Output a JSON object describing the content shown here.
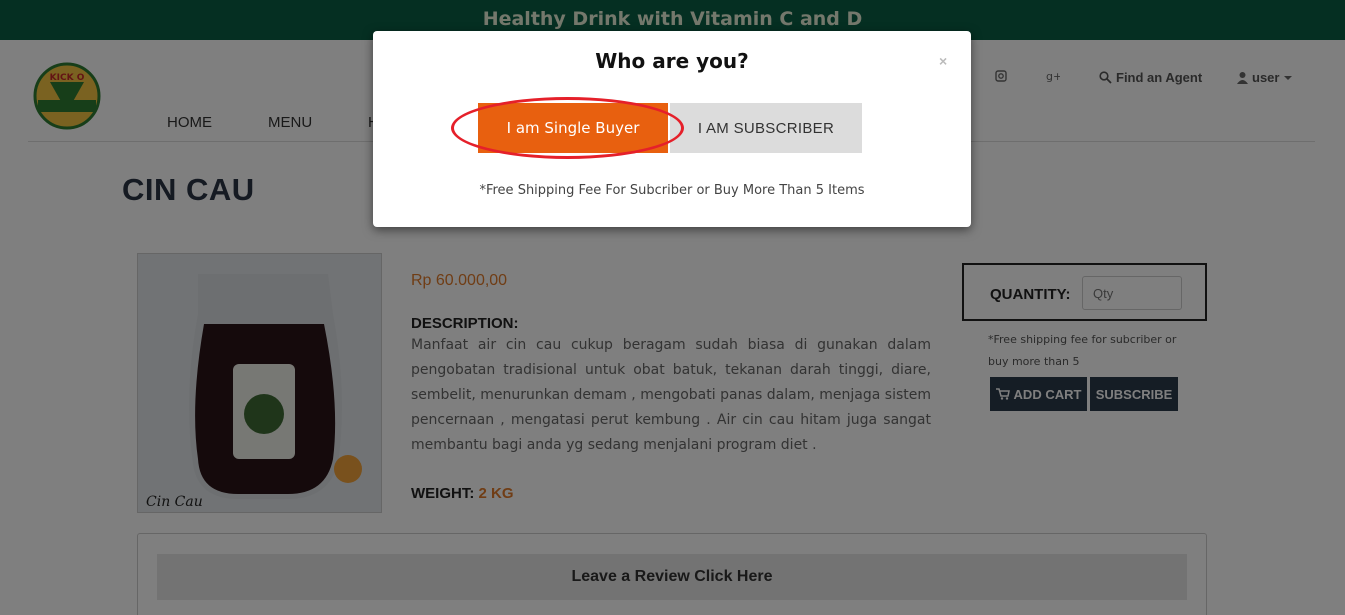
{
  "banner": {
    "text": "Healthy Drink with Vitamin C and D"
  },
  "logo": {
    "text": "KICK O"
  },
  "nav": {
    "home": "HOME",
    "menu": "MENU",
    "h": "H"
  },
  "header_right": {
    "instagram_icon": "instagram-icon",
    "googleplus_icon": "google-plus-icon",
    "find_agent": "Find an Agent",
    "user": "user"
  },
  "product": {
    "title": "CIN CAU",
    "image_caption": "Cin Cau",
    "price": "Rp 60.000,00",
    "description_label": "DESCRIPTION:",
    "description": "Manfaat air cin cau cukup beragam sudah biasa di gunakan dalam pengobatan tradisional untuk obat batuk, tekanan darah tinggi, diare, sembelit, menurunkan demam , mengobati panas dalam, menjaga sistem pencernaan , mengatasi perut kembung . Air cin cau hitam juga sangat membantu bagi anda yg sedang menjalani program diet .",
    "weight_label": "WEIGHT:",
    "weight_value": "2 KG"
  },
  "purchase": {
    "quantity_label": "QUANTITY:",
    "qty_placeholder": "Qty",
    "shipping_note": "*Free shipping fee for subcriber or buy more than 5",
    "add_cart": "ADD CART",
    "subscribe": "SUBSCRIBE"
  },
  "review": {
    "button": "Leave a Review Click Here"
  },
  "modal": {
    "title": "Who are you?",
    "close": "×",
    "single_buyer": "I am Single Buyer",
    "subscriber": "I AM SUBSCRIBER",
    "note": "*Free Shipping Fee For Subcriber or Buy More Than 5 Items"
  },
  "colors": {
    "banner": "#0b5f45",
    "accent_orange": "#e8600f",
    "price": "#e07a2a",
    "dark_button": "#2b3a4a",
    "highlight_circle": "#e5202a"
  }
}
